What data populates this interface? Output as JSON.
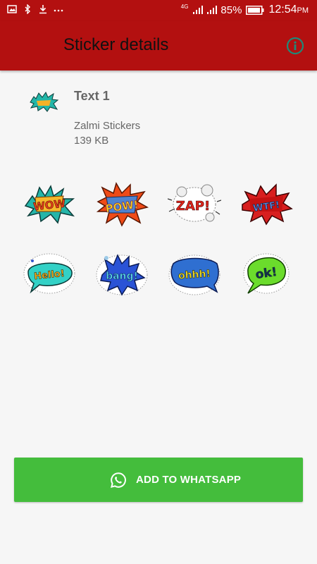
{
  "status_bar": {
    "battery": "85%",
    "time": "12:54",
    "ampm": "PM",
    "network": "4G",
    "icons": [
      "image-icon",
      "bluetooth-icon",
      "download-icon",
      "more-dots-icon",
      "wifi-icon",
      "signal-icon",
      "signal-2-icon",
      "battery-icon"
    ]
  },
  "app_bar": {
    "title": "Sticker details",
    "info_icon": "info-icon"
  },
  "pack": {
    "name": "Text 1",
    "author": "Zalmi Stickers",
    "size": "139 KB"
  },
  "stickers": [
    {
      "text": "WOW",
      "icon": "wow-sticker"
    },
    {
      "text": "POW!",
      "icon": "pow-sticker"
    },
    {
      "text": "ZAP!",
      "icon": "zap-sticker"
    },
    {
      "text": "WTF!",
      "icon": "wtf-sticker"
    },
    {
      "text": "Hello!",
      "icon": "hello-sticker"
    },
    {
      "text": "bang!",
      "icon": "bang-sticker"
    },
    {
      "text": "ohhh!",
      "icon": "ohhh-sticker"
    },
    {
      "text": "ok!",
      "icon": "ok-sticker"
    }
  ],
  "add_button": {
    "label": "ADD TO WHATSAPP",
    "icon": "whatsapp-icon"
  },
  "colors": {
    "app_bar": "#b31010",
    "button": "#44bd3c",
    "background": "#f6f6f6"
  }
}
